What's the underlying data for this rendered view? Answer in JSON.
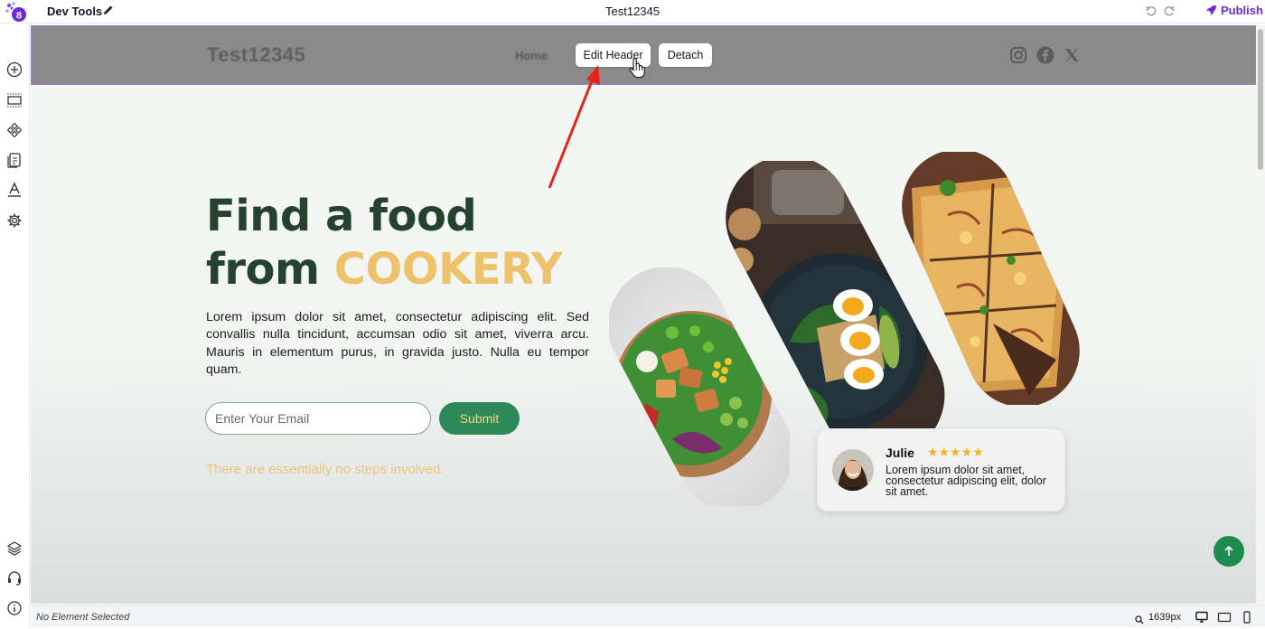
{
  "topbar": {
    "app_title": "Dev Tools",
    "page_name": "Test12345",
    "publish_label": "Publish"
  },
  "header": {
    "logo_text": "Test12345",
    "nav_home": "Home",
    "edit_header_label": "Edit Header",
    "detach_label": "Detach",
    "social_icons": [
      "instagram-icon",
      "facebook-icon",
      "x-icon"
    ]
  },
  "hero": {
    "title_line1": "Find a food",
    "title_line2_prefix": "from ",
    "title_accent": "COOKERY",
    "body": "Lorem ipsum dolor sit amet, consectetur adipiscing elit. Sed convallis nulla tincidunt, accumsan odio sit amet, viverra arcu. Mauris in elementum purus, in gravida justo. Nulla eu tempor quam.",
    "email_placeholder": "Enter Your Email",
    "submit_label": "Submit",
    "note": "There are essentially no steps involved."
  },
  "review": {
    "name": "Julie",
    "stars": "★★★★★",
    "rating": 5,
    "text": "Lorem ipsum dolor sit amet, consectetur adipiscing elit, dolor sit amet."
  },
  "statusbar": {
    "selection": "No Element Selected",
    "width_readout": "1639px"
  },
  "colors": {
    "brand_purple": "#6d28d9",
    "hero_green": "#25422f",
    "accent_yellow": "#edc26a",
    "button_green": "#2b8a57",
    "arrow_red": "#e8221b"
  }
}
